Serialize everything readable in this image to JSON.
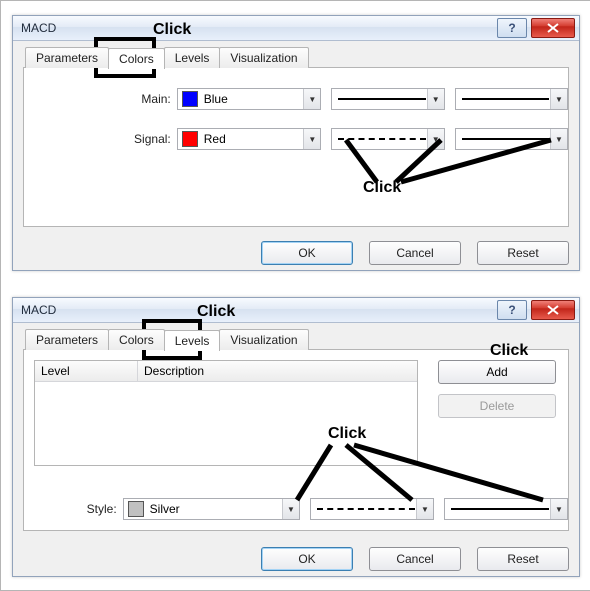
{
  "dialog1": {
    "title": "MACD",
    "tabs": [
      "Parameters",
      "Colors",
      "Levels",
      "Visualization"
    ],
    "active_tab_index": 1,
    "rows": {
      "main": {
        "label": "Main:",
        "color_name": "Blue",
        "color_hex": "#0000FF"
      },
      "signal": {
        "label": "Signal:",
        "color_name": "Red",
        "color_hex": "#FF0000"
      }
    },
    "buttons": {
      "ok": "OK",
      "cancel": "Cancel",
      "reset": "Reset"
    },
    "annotation_tab": "Click",
    "annotation_arrows": "Click"
  },
  "dialog2": {
    "title": "MACD",
    "tabs": [
      "Parameters",
      "Colors",
      "Levels",
      "Visualization"
    ],
    "active_tab_index": 2,
    "list": {
      "col_level": "Level",
      "col_description": "Description"
    },
    "side_buttons": {
      "add": "Add",
      "delete": "Delete"
    },
    "style": {
      "label": "Style:",
      "color_name": "Silver",
      "color_hex": "#C0C0C0"
    },
    "buttons": {
      "ok": "OK",
      "cancel": "Cancel",
      "reset": "Reset"
    },
    "annotation_tab": "Click",
    "annotation_add": "Click",
    "annotation_arrows": "Click"
  }
}
